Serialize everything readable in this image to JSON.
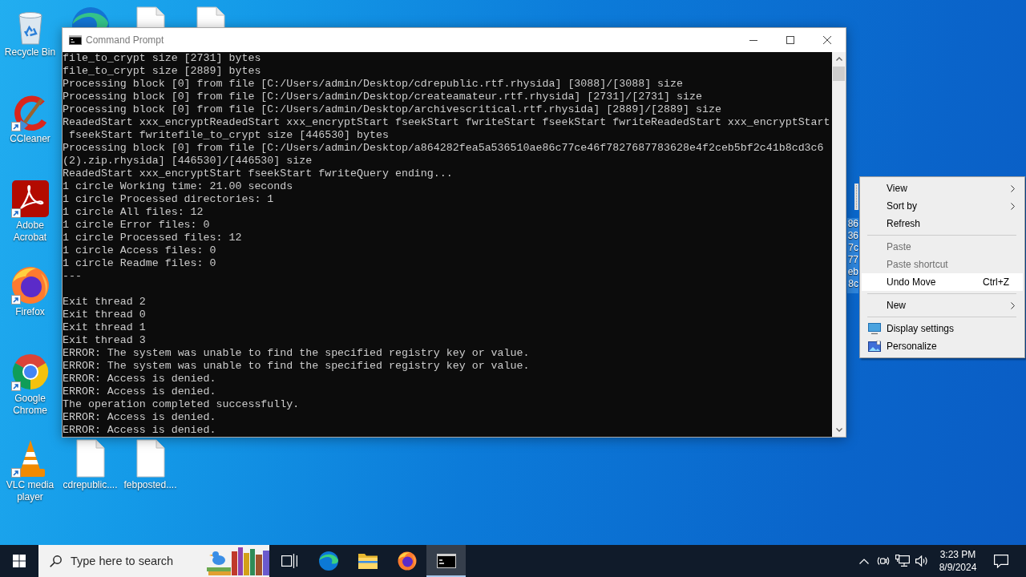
{
  "desktop": {
    "left_column": [
      {
        "kind": "bin",
        "label": "Recycle Bin",
        "shortcut": false
      },
      {
        "kind": "cleaner",
        "label": "CCleaner",
        "shortcut": true
      },
      {
        "kind": "acrobat",
        "label": "Adobe Acrobat",
        "shortcut": true
      },
      {
        "kind": "firefox",
        "label": "Firefox",
        "shortcut": true
      },
      {
        "kind": "chrome",
        "label": "Google Chrome",
        "shortcut": true
      },
      {
        "kind": "vlc",
        "label": "VLC media player",
        "shortcut": true
      }
    ],
    "top_row": [
      {
        "kind": "edge"
      },
      {
        "kind": "file"
      },
      {
        "kind": "file"
      }
    ],
    "bottom_row": [
      {
        "kind": "file",
        "label": "cdrepublic...."
      },
      {
        "kind": "file",
        "label": "febposted...."
      }
    ],
    "right_file": {
      "label_lines": [
        "86",
        "36",
        "7c",
        "77",
        "eb",
        "8c"
      ],
      "selected": true
    }
  },
  "window": {
    "title": "Command Prompt",
    "active": false,
    "console": {
      "blocks": [
        [
          "file_to_crypt size [2731] bytes",
          "file_to_crypt size [2889] bytes",
          "Processing block [0] from file [C:/Users/admin/Desktop/cdrepublic.rtf.rhysida] [3088]/[3088] size",
          "Processing block [0] from file [C:/Users/admin/Desktop/createamateur.rtf.rhysida] [2731]/[2731] size",
          "Processing block [0] from file [C:/Users/admin/Desktop/archivescritical.rtf.rhysida] [2889]/[2889] size",
          "ReadedStart xxx_encryptReadedStart xxx_encryptStart fseekStart fwriteStart fseekStart fwriteReadedStart xxx_encryptStart",
          " fseekStart fwritefile_to_crypt size [446530] bytes",
          "Processing block [0] from file [C:/Users/admin/Desktop/a864282fea5a536510ae86c77ce46f7827687783628e4f2ceb5bf2c41b8cd3c6",
          "(2).zip.rhysida] [446530]/[446530] size",
          "ReadedStart xxx_encryptStart fseekStart fwriteQuery ending...",
          "1 circle Working time: 21.00 seconds",
          "1 circle Processed directories: 1",
          "1 circle All files: 12",
          "1 circle Error files: 0",
          "1 circle Processed files: 12",
          "1 circle Access files: 0",
          "1 circle Readme files: 0",
          "---"
        ],
        [
          "Exit thread 2",
          "Exit thread 0",
          "Exit thread 1",
          "Exit thread 3",
          "ERROR: The system was unable to find the specified registry key or value.",
          "ERROR: The system was unable to find the specified registry key or value.",
          "ERROR: Access is denied.",
          "ERROR: Access is denied.",
          "The operation completed successfully.",
          "ERROR: Access is denied.",
          "ERROR: Access is denied."
        ]
      ]
    }
  },
  "context_menu": {
    "groups": [
      [
        {
          "label": "View",
          "submenu": true,
          "disabled": false,
          "highlighted": false
        },
        {
          "label": "Sort by",
          "submenu": true,
          "disabled": false,
          "highlighted": false
        },
        {
          "label": "Refresh",
          "submenu": false,
          "disabled": false,
          "highlighted": false
        }
      ],
      [
        {
          "label": "Paste",
          "submenu": false,
          "disabled": true,
          "highlighted": false
        },
        {
          "label": "Paste shortcut",
          "submenu": false,
          "disabled": true,
          "highlighted": false
        },
        {
          "label": "Undo Move",
          "shortcut_key": "Ctrl+Z",
          "submenu": false,
          "disabled": false,
          "highlighted": true
        }
      ],
      [
        {
          "label": "New",
          "submenu": true,
          "disabled": false,
          "highlighted": false
        }
      ],
      [
        {
          "label": "Display settings",
          "submenu": false,
          "disabled": false,
          "highlighted": false
        },
        {
          "label": "Personalize",
          "submenu": false,
          "disabled": false,
          "highlighted": false
        }
      ]
    ]
  },
  "taskbar": {
    "search": {
      "placeholder": "Type here to search"
    },
    "apps": [
      {
        "kind": "taskview",
        "open": false
      },
      {
        "kind": "edge",
        "open": false
      },
      {
        "kind": "explorer",
        "open": false
      },
      {
        "kind": "firefox",
        "open": false
      },
      {
        "kind": "terminal",
        "open": true
      }
    ],
    "clock": {
      "time": "3:23 PM",
      "date": "8/9/2024"
    }
  }
}
